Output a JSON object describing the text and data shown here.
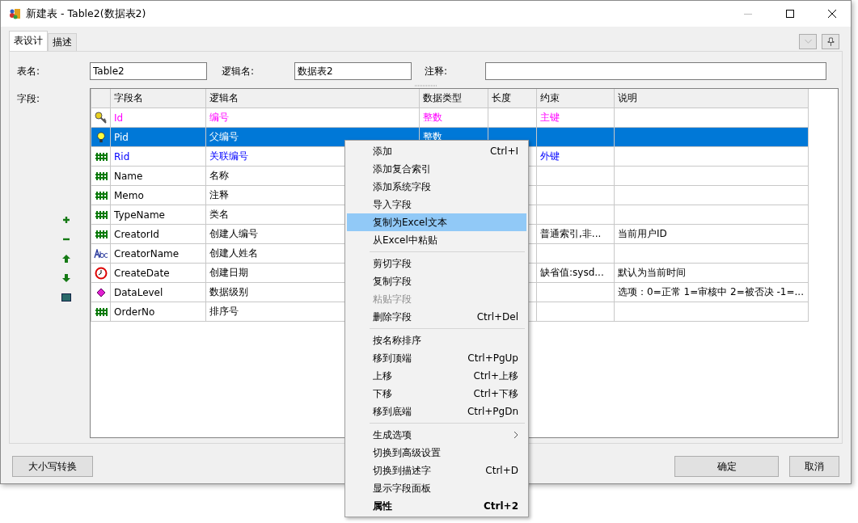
{
  "window": {
    "title": "新建表 - Table2(数据表2)"
  },
  "tabs": [
    {
      "label": "表设计",
      "selected": true
    },
    {
      "label": "描述",
      "selected": false
    }
  ],
  "form": {
    "table_name": {
      "label": "表名:",
      "value": "Table2"
    },
    "logical_name": {
      "label": "逻辑名:",
      "value": "数据表2"
    },
    "comment": {
      "label": "注释:"
    },
    "fields_label": "字段:"
  },
  "table": {
    "columns": [
      "字段名",
      "逻辑名",
      "数据类型",
      "长度",
      "约束",
      "说明"
    ],
    "rows": [
      {
        "kind": "key",
        "name": "Id",
        "logical": "编号",
        "type": "整数",
        "constraint": "主键",
        "color": "#ff00ff",
        "selected": false
      },
      {
        "kind": "bulb",
        "name": "Pid",
        "logical": "父编号",
        "type": "整数",
        "selected": true
      },
      {
        "kind": "grid",
        "name": "Rid",
        "logical": "关联编号",
        "constraint": "外键",
        "color": "#0000ff",
        "selected": false
      },
      {
        "kind": "grid",
        "name": "Name",
        "logical": "名称",
        "color": "#000000",
        "selected": false
      },
      {
        "kind": "grid",
        "name": "Memo",
        "logical": "注释",
        "color": "#000000",
        "selected": false
      },
      {
        "kind": "grid",
        "name": "TypeName",
        "logical": "类名",
        "color": "#000000",
        "selected": false
      },
      {
        "kind": "grid",
        "name": "CreatorId",
        "logical": "创建人编号",
        "constraint": "普通索引,非...",
        "note": "当前用户ID",
        "color": "#000000",
        "selected": false
      },
      {
        "kind": "text",
        "name": "CreatorName",
        "logical": "创建人姓名",
        "color": "#000000",
        "selected": false
      },
      {
        "kind": "clock",
        "name": "CreateDate",
        "logical": "创建日期",
        "constraint": "缺省值:sysd...",
        "note": "默认为当前时间",
        "color": "#000000",
        "selected": false
      },
      {
        "kind": "diamond",
        "name": "DataLevel",
        "logical": "数据级别",
        "note": "选项：0=正常 1=审核中 2=被否决 -1=...",
        "color": "#000000",
        "selected": false
      },
      {
        "kind": "grid",
        "name": "OrderNo",
        "logical": "排序号",
        "color": "#000000",
        "selected": false
      }
    ]
  },
  "side_tools": [
    {
      "kind": "add"
    },
    {
      "kind": "remove"
    },
    {
      "kind": "up"
    },
    {
      "kind": "down"
    },
    {
      "kind": "panel"
    }
  ],
  "buttons": {
    "case_convert": "大小写转换",
    "ok": "确定",
    "cancel": "取消"
  },
  "context_menu": [
    [
      {
        "label": "添加",
        "shortcut": "Ctrl+I",
        "selected": false,
        "disabled": false,
        "bold": false,
        "submenu": false
      },
      {
        "label": "添加复合索引",
        "selected": false,
        "disabled": false,
        "bold": false,
        "submenu": false
      },
      {
        "label": "添加系统字段",
        "selected": false,
        "disabled": false,
        "bold": false,
        "submenu": false
      },
      {
        "label": "导入字段",
        "selected": false,
        "disabled": false,
        "bold": false,
        "submenu": false
      },
      {
        "label": "复制为Excel文本",
        "selected": true,
        "disabled": false,
        "bold": false,
        "submenu": false
      },
      {
        "label": "从Excel中粘贴",
        "selected": false,
        "disabled": false,
        "bold": false,
        "submenu": false
      }
    ],
    [
      {
        "label": "剪切字段",
        "selected": false,
        "disabled": false,
        "bold": false,
        "submenu": false
      },
      {
        "label": "复制字段",
        "selected": false,
        "disabled": false,
        "bold": false,
        "submenu": false
      },
      {
        "label": "粘贴字段",
        "selected": false,
        "disabled": true,
        "bold": false,
        "submenu": false
      },
      {
        "label": "删除字段",
        "shortcut": "Ctrl+Del",
        "selected": false,
        "disabled": false,
        "bold": false,
        "submenu": false
      }
    ],
    [
      {
        "label": "按名称排序",
        "selected": false,
        "disabled": false,
        "bold": false,
        "submenu": false
      },
      {
        "label": "移到顶端",
        "shortcut": "Ctrl+PgUp",
        "selected": false,
        "disabled": false,
        "bold": false,
        "submenu": false
      },
      {
        "label": "上移",
        "shortcut": "Ctrl+上移",
        "selected": false,
        "disabled": false,
        "bold": false,
        "submenu": false
      },
      {
        "label": "下移",
        "shortcut": "Ctrl+下移",
        "selected": false,
        "disabled": false,
        "bold": false,
        "submenu": false
      },
      {
        "label": "移到底端",
        "shortcut": "Ctrl+PgDn",
        "selected": false,
        "disabled": false,
        "bold": false,
        "submenu": false
      }
    ],
    [
      {
        "label": "生成选项",
        "selected": false,
        "disabled": false,
        "bold": false,
        "submenu": true
      },
      {
        "label": "切换到高级设置",
        "selected": false,
        "disabled": false,
        "bold": false,
        "submenu": false
      },
      {
        "label": "切换到描述字",
        "shortcut": "Ctrl+D",
        "selected": false,
        "disabled": false,
        "bold": false,
        "submenu": false
      },
      {
        "label": "显示字段面板",
        "selected": false,
        "disabled": false,
        "bold": false,
        "submenu": false
      },
      {
        "label": "属性",
        "shortcut": "Ctrl+2",
        "selected": false,
        "disabled": false,
        "bold": true,
        "submenu": false
      }
    ]
  ]
}
